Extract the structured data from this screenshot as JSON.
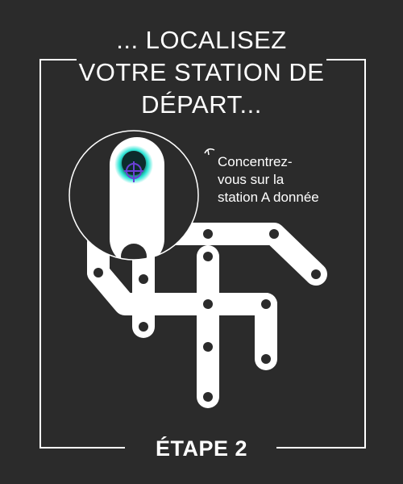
{
  "title_lines": [
    "... LOCALISEZ",
    "VOTRE STATION DE",
    "DÉPART..."
  ],
  "annotation_lines": [
    "Concentrez-",
    "vous sur la",
    "station A donnée"
  ],
  "step_label": "ÉTAPE 2",
  "colors": {
    "background": "#2b2b2b",
    "line": "#ffffff",
    "station": "#2b2b2b",
    "target_glow": "#2ee6d6",
    "target_ring": "#6a3fd6"
  },
  "icons": {
    "target": "crosshair-target-icon",
    "annotation_marker": "curved-arrow-icon"
  }
}
